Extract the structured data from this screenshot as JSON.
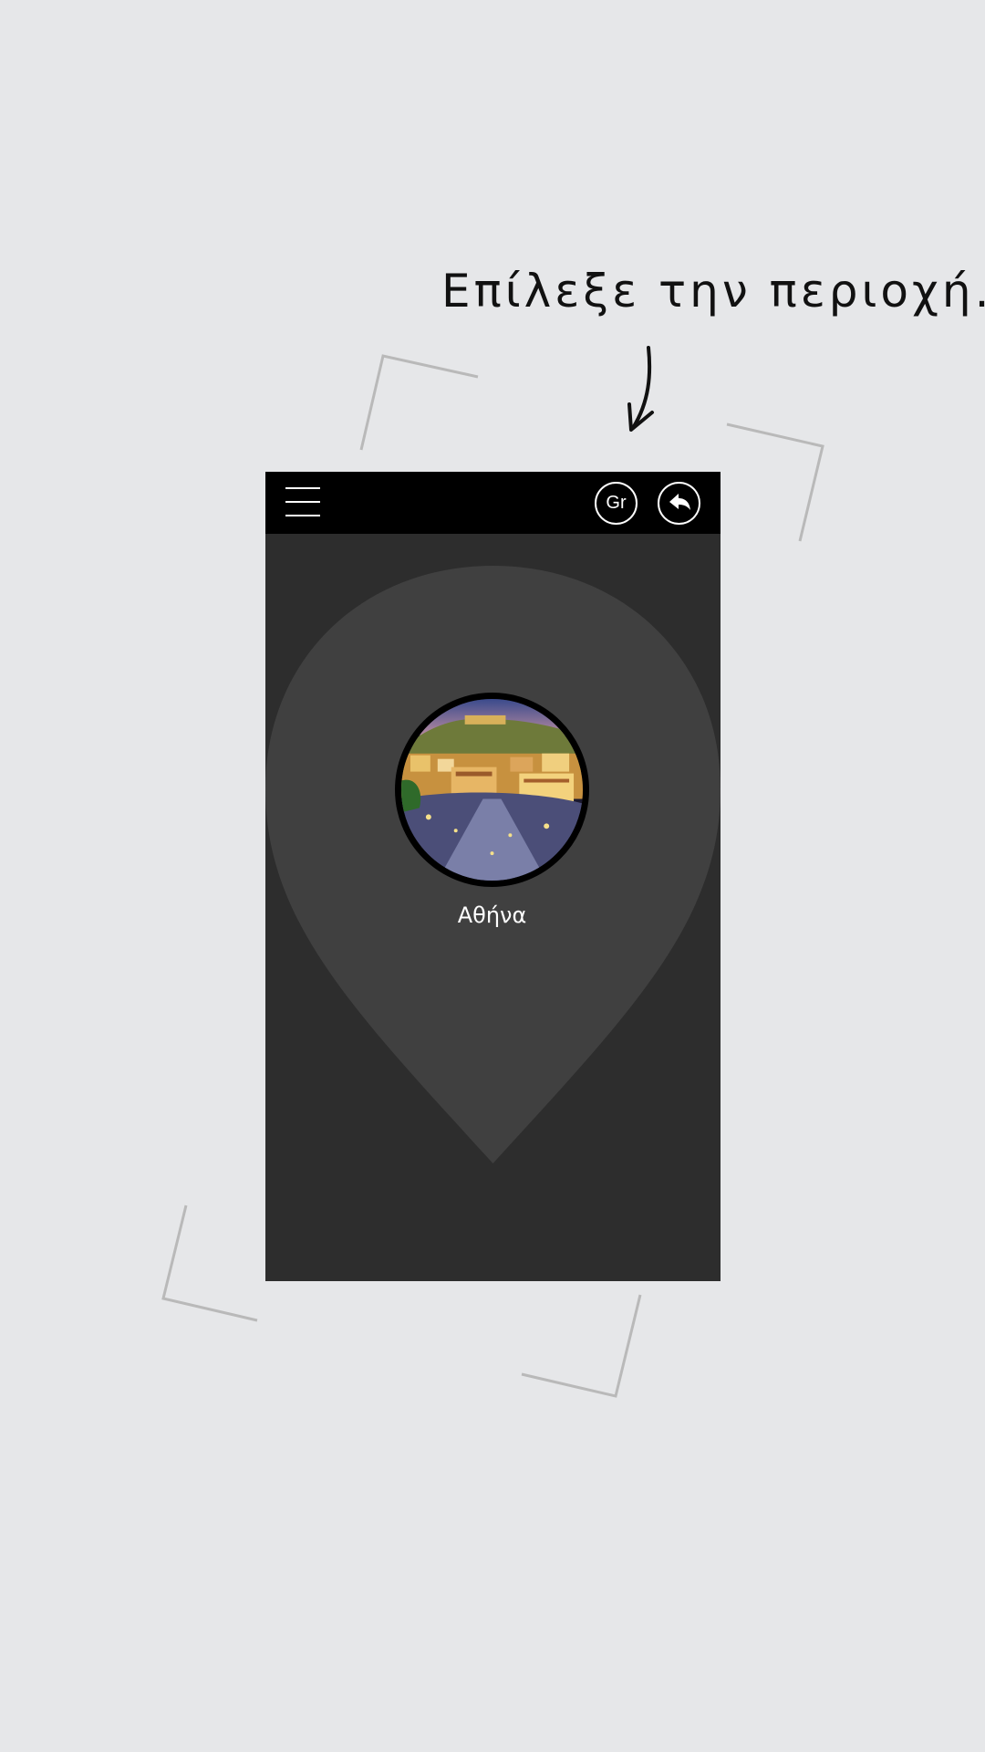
{
  "instruction": "Επίλεξε την περιοχή.",
  "header": {
    "menu_icon": "hamburger-menu-icon",
    "language_label": "Gr",
    "back_icon": "back-arrow-icon"
  },
  "locations": [
    {
      "name": "Αθήνα",
      "image": "athens-photo"
    }
  ],
  "colors": {
    "page_background": "#e6e7e9",
    "app_background": "#2d2d2d",
    "header_background": "#000000",
    "pin_color": "#404040",
    "frame_lines": "#b9b9b9"
  }
}
